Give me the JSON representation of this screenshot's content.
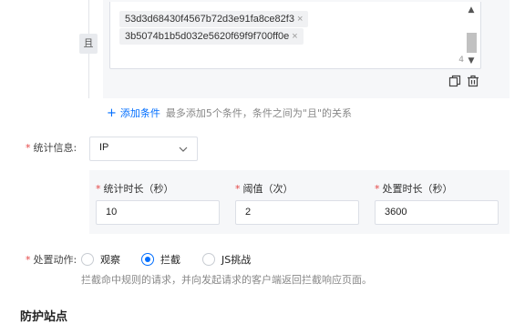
{
  "condition": {
    "and_label": "且",
    "tags": [
      "53d3d68430f4567b72d3e91fa8ce82f3",
      "3b5074b1b5d032e5620f69f9f700ff0e"
    ],
    "tag_close": "×",
    "count": "4",
    "add_label": "添加条件",
    "add_hint": "最多添加5个条件，条件之间为\"且\"的关系"
  },
  "stats": {
    "label": "统计信息:",
    "selected": "IP",
    "fields": [
      {
        "label": "统计时长（秒）",
        "value": "10"
      },
      {
        "label": "阈值（次）",
        "value": "2"
      },
      {
        "label": "处置时长（秒）",
        "value": "3600"
      }
    ]
  },
  "action": {
    "label": "处置动作:",
    "options": [
      "观察",
      "拦截",
      "JS挑战"
    ],
    "selected": "拦截",
    "description": "拦截命中规则的请求，并向发起请求的客户端返回拦截响应页面。"
  },
  "section": {
    "title": "防护站点"
  },
  "colors": {
    "accent": "#006eff",
    "required": "#e54545",
    "panel": "#f6f7f9"
  }
}
